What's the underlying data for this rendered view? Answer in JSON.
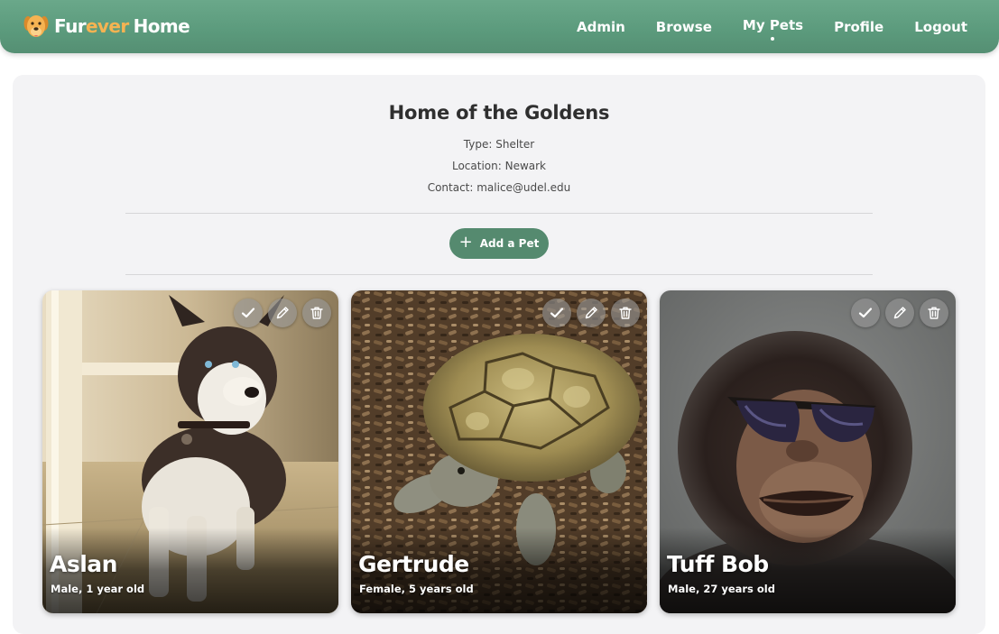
{
  "brand": {
    "fur": "Fur",
    "ever": "ever",
    "home": "Home",
    "accent": "#f5b352",
    "logo_icon": "dog-face-icon"
  },
  "nav": {
    "items": [
      {
        "label": "Admin",
        "active": false
      },
      {
        "label": "Browse",
        "active": false
      },
      {
        "label": "My Pets",
        "active": true
      },
      {
        "label": "Profile",
        "active": false
      },
      {
        "label": "Logout",
        "active": false
      }
    ],
    "color": "#5e9c7e"
  },
  "organization": {
    "name": "Home of the Goldens",
    "type": "Type: Shelter",
    "location": "Location: Newark",
    "contact": "Contact: malice@udel.edu"
  },
  "add_pet_button": {
    "label": "Add a Pet",
    "icon": "plus-icon",
    "color": "#558a6f"
  },
  "pets": [
    {
      "name": "Aslan",
      "info": "Male, 1 year old",
      "photo": "husky-dog"
    },
    {
      "name": "Gertrude",
      "info": "Female, 5 years old",
      "photo": "tortoise"
    },
    {
      "name": "Tuff Bob",
      "info": "Male, 27 years old",
      "photo": "chimpanzee-with-sunglasses"
    }
  ],
  "card_actions": [
    "check-icon",
    "pencil-icon",
    "trash-icon"
  ]
}
